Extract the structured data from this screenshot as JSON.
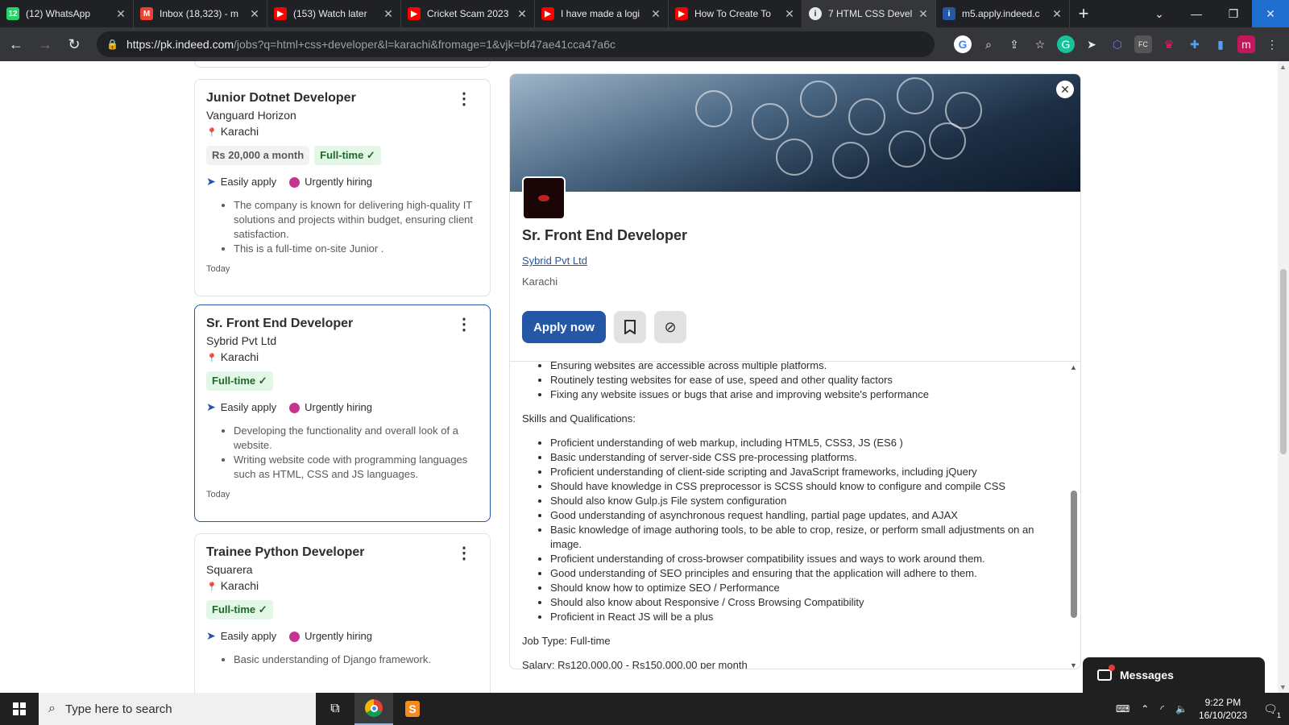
{
  "browser": {
    "tabs": [
      {
        "title": "(12) WhatsApp",
        "fav_color": "#25d366",
        "fav_glyph": "12",
        "icon": "whatsapp-icon"
      },
      {
        "title": "Inbox (18,323) - m",
        "fav_color": "#ea4335",
        "fav_glyph": "M",
        "icon": "gmail-icon"
      },
      {
        "title": "(153) Watch later",
        "fav_color": "#ff0000",
        "fav_glyph": "▶",
        "icon": "youtube-icon"
      },
      {
        "title": "Cricket Scam 2023",
        "fav_color": "#ff0000",
        "fav_glyph": "▶",
        "icon": "youtube-icon"
      },
      {
        "title": "I have made a logi",
        "fav_color": "#ff0000",
        "fav_glyph": "▶",
        "icon": "youtube-icon"
      },
      {
        "title": "How To Create To",
        "fav_color": "#ff0000",
        "fav_glyph": "▶",
        "icon": "youtube-icon"
      },
      {
        "title": "7 HTML CSS Devel",
        "fav_color": "#e8eaed",
        "fav_glyph": "i",
        "icon": "indeed-icon"
      },
      {
        "title": "m5.apply.indeed.c",
        "fav_color": "#2557a7",
        "fav_glyph": "i",
        "icon": "indeed-icon"
      }
    ],
    "active_tab": 6,
    "url_host": "https://pk.indeed.com",
    "url_rest": "/jobs?q=html+css+developer&l=karachi&fromage=1&vjk=bf47ae41cca47a6c",
    "avatar_letter": "m"
  },
  "job_cards": [
    {
      "title": "Junior Dotnet Developer",
      "company": "Vanguard Horizon",
      "location": "Karachi",
      "salary": "Rs 20,000 a month",
      "job_type": "Full-time ✓",
      "easily_apply": "Easily apply",
      "urgent": "Urgently hiring",
      "snippets": [
        "The company is known for delivering high-quality IT solutions and projects within budget, ensuring client satisfaction.",
        "This is a full-time on-site Junior ."
      ],
      "date": "Today"
    },
    {
      "title": "Sr. Front End Developer",
      "company": "Sybrid Pvt Ltd",
      "location": "Karachi",
      "salary": "",
      "job_type": "Full-time ✓",
      "easily_apply": "Easily apply",
      "urgent": "Urgently hiring",
      "snippets": [
        "Developing the functionality and overall look of a website.",
        "Writing website code with programming languages such as HTML, CSS and JS languages."
      ],
      "date": "Today"
    },
    {
      "title": "Trainee Python Developer",
      "company": "Squarera",
      "location": "Karachi",
      "salary": "",
      "job_type": "Full-time ✓",
      "easily_apply": "Easily apply",
      "urgent": "Urgently hiring",
      "snippets": [
        "Basic understanding of Django framework."
      ],
      "date": ""
    }
  ],
  "details": {
    "title": "Sr. Front End Developer",
    "company": "Sybrid Pvt Ltd",
    "location": "Karachi",
    "apply_label": "Apply now",
    "close_glyph": "✕",
    "save_glyph": "🔖",
    "not_interested_glyph": "⊘",
    "top_bullets": [
      "Ensuring websites are accessible across multiple platforms.",
      "Routinely testing websites for ease of use, speed and other quality factors",
      "Fixing any website issues or bugs that arise and improving website's performance"
    ],
    "skills_heading": "Skills and Qualifications:",
    "skills": [
      "Proficient understanding of web markup, including HTML5, CSS3, JS (ES6 )",
      "Basic understanding of server-side CSS pre-processing platforms.",
      "Proficient understanding of client-side scripting and JavaScript frameworks, including jQuery",
      "Should have knowledge in CSS preprocessor is SCSS should know to configure and compile CSS",
      "Should also know Gulp.js File system configuration",
      "Good understanding of asynchronous request handling, partial page updates, and AJAX",
      "Basic knowledge of image authoring tools, to be able to crop, resize, or perform small adjustments on an image.",
      "Proficient understanding of cross-browser compatibility issues and ways to work around them.",
      "Good understanding of SEO principles and ensuring that the application will adhere to them.",
      "Should know how to optimize SEO / Performance",
      "Should also know about Responsive / Cross Browsing Compatibility",
      "Proficient in React JS will be a plus"
    ],
    "job_type": "Job Type: Full-time",
    "salary": "Salary: Rs120,000.00 - Rs150,000.00 per month"
  },
  "messages_label": "Messages",
  "taskbar": {
    "search_placeholder": "Type here to search",
    "time": "9:22 PM",
    "date": "16/10/2023",
    "notif_count": "1"
  },
  "colors": {
    "accent": "#2557a7",
    "fulltime_bg": "#e4f7e6",
    "urgent": "#c7338f"
  }
}
